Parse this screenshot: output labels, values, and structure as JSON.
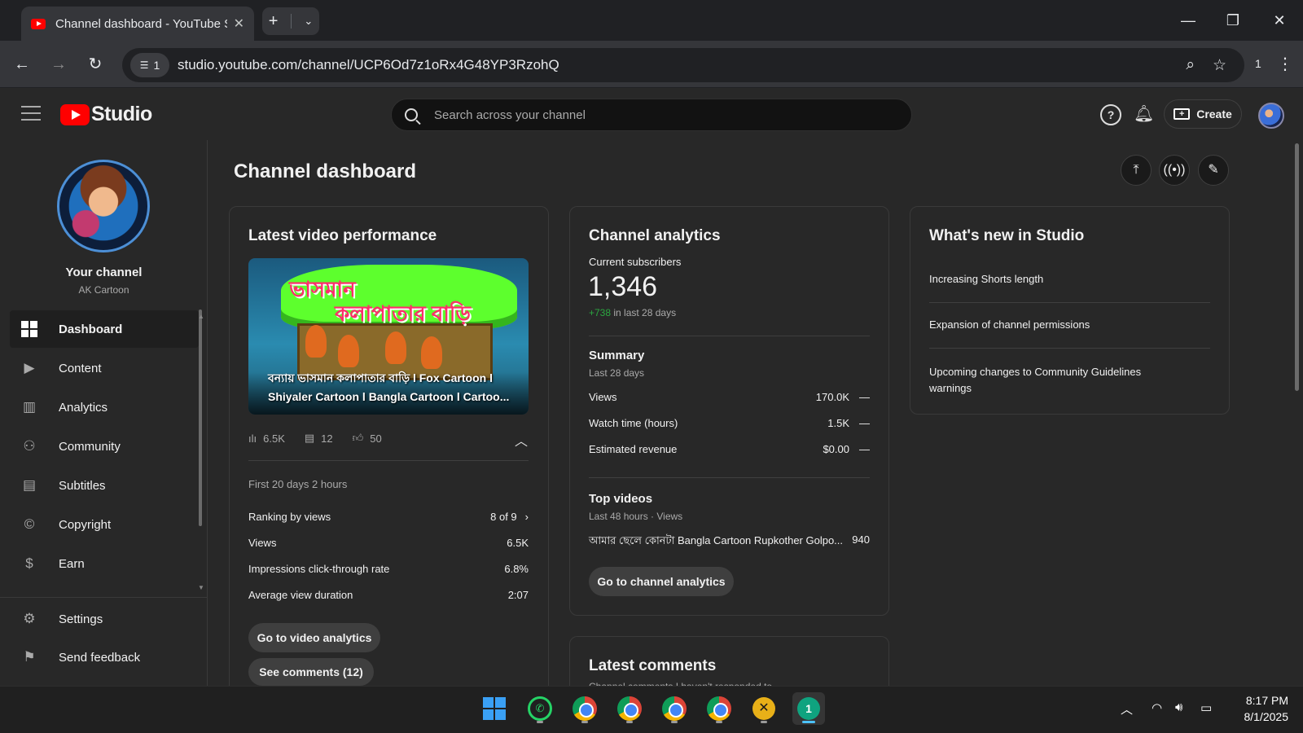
{
  "browser": {
    "tab_title": "Channel dashboard - YouTube Studio",
    "site_info": "1",
    "url": "studio.youtube.com/channel/UCP6Od7z1oRx4G48YP3RzohQ",
    "extensions_count": "1"
  },
  "header": {
    "logo_text": "Studio",
    "search_placeholder": "Search across your channel",
    "create_label": "Create"
  },
  "sidebar": {
    "your_channel": "Your channel",
    "channel_name": "AK Cartoon",
    "items": [
      {
        "label": "Dashboard",
        "icon": "dashboard-icon",
        "active": true
      },
      {
        "label": "Content",
        "icon": "content-icon"
      },
      {
        "label": "Analytics",
        "icon": "analytics-icon"
      },
      {
        "label": "Community",
        "icon": "community-icon"
      },
      {
        "label": "Subtitles",
        "icon": "subtitles-icon"
      },
      {
        "label": "Copyright",
        "icon": "copyright-icon"
      },
      {
        "label": "Earn",
        "icon": "earn-icon"
      }
    ],
    "bottom_items": [
      {
        "label": "Settings",
        "icon": "gear-icon"
      },
      {
        "label": "Send feedback",
        "icon": "feedback-icon"
      }
    ]
  },
  "main": {
    "page_title": "Channel dashboard",
    "latest_video": {
      "title": "Latest video performance",
      "thumb_text_line1": "ভাসমান",
      "thumb_text_line2": "কলাপাতার বাড়ি",
      "video_title": "বন্যায় ভাসমান কলাপাতার বাড়ি l Fox Cartoon l Shiyaler Cartoon l Bangla Cartoon l Cartoo...",
      "views": "6.5K",
      "comments": "12",
      "likes": "50",
      "period": "First 20 days 2 hours",
      "rows": [
        {
          "label": "Ranking by views",
          "value": "8 of 9"
        },
        {
          "label": "Views",
          "value": "6.5K"
        },
        {
          "label": "Impressions click-through rate",
          "value": "6.8%"
        },
        {
          "label": "Average view duration",
          "value": "2:07"
        }
      ],
      "analytics_button": "Go to video analytics",
      "comments_button": "See comments (12)"
    },
    "channel_analytics": {
      "title": "Channel analytics",
      "subscribers_label": "Current subscribers",
      "subscribers": "1,346",
      "subscribers_change": "+738",
      "subscribers_change_period": "in last 28 days",
      "summary_title": "Summary",
      "summary_period": "Last 28 days",
      "summary_rows": [
        {
          "label": "Views",
          "value": "170.0K",
          "trend": "—"
        },
        {
          "label": "Watch time (hours)",
          "value": "1.5K",
          "trend": "—"
        },
        {
          "label": "Estimated revenue",
          "value": "$0.00",
          "trend": "—"
        }
      ],
      "top_videos_title": "Top videos",
      "top_videos_period": "Last 48 hours · Views",
      "top_video": {
        "title": "আমার ছেলে কোনটা Bangla Cartoon Rupkother Golpo...",
        "views": "940"
      },
      "button": "Go to channel analytics"
    },
    "whats_new": {
      "title": "What's new in Studio",
      "items": [
        "Increasing Shorts length",
        "Expansion of channel permissions",
        "Upcoming changes to Community Guidelines warnings"
      ]
    },
    "latest_comments": {
      "title": "Latest comments",
      "subtitle": "Channel comments I haven't responded to"
    }
  },
  "taskbar": {
    "time": "8:17 PM",
    "date": "8/1/2025"
  },
  "colors": {
    "accent_red": "#ff0000",
    "positive_green": "#2ba640",
    "background": "#282828"
  }
}
